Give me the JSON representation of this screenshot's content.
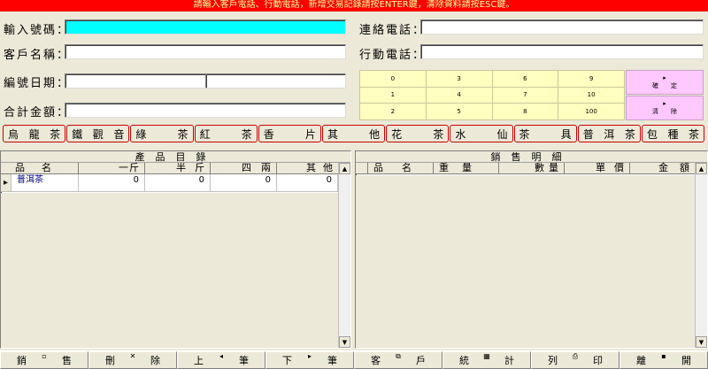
{
  "banner": "請輸入客戶電話、行動電話，新增交易記錄請按ENTER鍵，清除資料請按ESC鍵。",
  "form": {
    "input_number_label": "輸入號碼：",
    "contact_phone_label": "連絡電話：",
    "customer_name_label": "客戶名稱：",
    "mobile_phone_label": "行動電話：",
    "serial_date_label": "編號日期：",
    "total_amount_label": "合計金額："
  },
  "keypad": [
    "0",
    "3",
    "6",
    "9",
    "1",
    "4",
    "7",
    "10",
    "2",
    "5",
    "8",
    "100"
  ],
  "actions": {
    "confirm": "確　　定",
    "clear": "清　　除"
  },
  "categories": [
    [
      "烏",
      "龍",
      "茶"
    ],
    [
      "鐵",
      "觀",
      "音"
    ],
    [
      "綠",
      "茶"
    ],
    [
      "紅",
      "茶"
    ],
    [
      "香",
      "片"
    ],
    [
      "其",
      "他"
    ],
    [
      "花",
      "茶"
    ],
    [
      "水",
      "仙"
    ],
    [
      "茶",
      "具"
    ],
    [
      "普",
      "洱",
      "茶"
    ],
    [
      "包",
      "種",
      "茶"
    ]
  ],
  "catalog": {
    "title": "產品目錄",
    "columns": [
      [
        "品",
        "名"
      ],
      [
        "一",
        "斤"
      ],
      [
        "半",
        "斤"
      ],
      [
        "四",
        "兩"
      ],
      [
        "其",
        "他"
      ]
    ],
    "rows": [
      {
        "name": "普洱茶",
        "c1": "0",
        "c2": "0",
        "c3": "0",
        "c4": "0"
      }
    ]
  },
  "sales": {
    "title": "銷售明細",
    "columns": [
      [
        "品",
        "名"
      ],
      [
        "重",
        "量"
      ],
      [
        "數",
        "量"
      ],
      [
        "單",
        "價"
      ],
      [
        "金",
        "額"
      ]
    ]
  },
  "toolbar": [
    {
      "label": [
        "銷",
        "售"
      ],
      "icon": "document-icon",
      "glyph": "▫"
    },
    {
      "label": [
        "刪",
        "除"
      ],
      "icon": "delete-icon",
      "glyph": "✕"
    },
    {
      "label": [
        "上",
        "筆"
      ],
      "icon": "prev-icon",
      "glyph": "◂"
    },
    {
      "label": [
        "下",
        "筆"
      ],
      "icon": "next-icon",
      "glyph": "▸"
    },
    {
      "label": [
        "客",
        "戶"
      ],
      "icon": "customer-icon",
      "glyph": "⧉"
    },
    {
      "label": [
        "統",
        "計"
      ],
      "icon": "stats-icon",
      "glyph": "▦"
    },
    {
      "label": [
        "列",
        "印"
      ],
      "icon": "print-icon",
      "glyph": "⎙"
    },
    {
      "label": [
        "離",
        "開"
      ],
      "icon": "save-exit-icon",
      "glyph": "▪"
    }
  ]
}
